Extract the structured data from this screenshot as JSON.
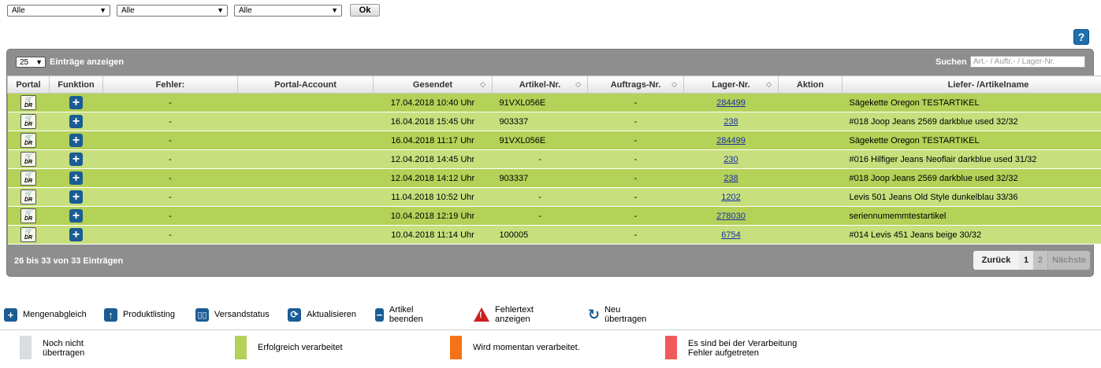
{
  "filters": [
    {
      "value": "Alle"
    },
    {
      "value": "Alle"
    },
    {
      "value": "Alle"
    }
  ],
  "ok_label": "Ok",
  "help_label": "?",
  "panel": {
    "page_length": "25",
    "length_label": "Einträge anzeigen",
    "search_label": "Suchen",
    "search_placeholder": "Art.- / Auftr.- / Lager-Nr."
  },
  "columns": [
    "Portal",
    "Funktion",
    "Fehler:",
    "Portal-Account",
    "Gesendet",
    "Artikel-Nr.",
    "Auftrags-Nr.",
    "Lager-Nr.",
    "Aktion",
    "Liefer- /Artikelname"
  ],
  "rows": [
    {
      "fehler": "-",
      "account": "",
      "gesendet": "17.04.2018 10:40 Uhr",
      "artikel": "91VXL056E",
      "auftrag": "-",
      "lager": "284499",
      "aktion": "",
      "name": "Sägekette Oregon TESTARTIKEL"
    },
    {
      "fehler": "-",
      "account": "",
      "gesendet": "16.04.2018 15:45 Uhr",
      "artikel": "903337",
      "auftrag": "-",
      "lager": "238",
      "aktion": "",
      "name": "#018 Joop Jeans 2569 darkblue used 32/32"
    },
    {
      "fehler": "-",
      "account": "",
      "gesendet": "16.04.2018 11:17 Uhr",
      "artikel": "91VXL056E",
      "auftrag": "-",
      "lager": "284499",
      "aktion": "",
      "name": "Sägekette Oregon TESTARTIKEL"
    },
    {
      "fehler": "-",
      "account": "",
      "gesendet": "12.04.2018 14:45 Uhr",
      "artikel": "-",
      "auftrag": "-",
      "lager": "230",
      "aktion": "",
      "name": "#016 Hilfiger Jeans Neoflair darkblue used 31/32"
    },
    {
      "fehler": "-",
      "account": "",
      "gesendet": "12.04.2018 14:12 Uhr",
      "artikel": "903337",
      "auftrag": "-",
      "lager": "238",
      "aktion": "",
      "name": "#018 Joop Jeans 2569 darkblue used 32/32"
    },
    {
      "fehler": "-",
      "account": "",
      "gesendet": "11.04.2018 10:52 Uhr",
      "artikel": "-",
      "auftrag": "-",
      "lager": "1202",
      "aktion": "",
      "name": "Levis 501 Jeans Old Style dunkelblau 33/36"
    },
    {
      "fehler": "-",
      "account": "",
      "gesendet": "10.04.2018 12:19 Uhr",
      "artikel": "-",
      "auftrag": "-",
      "lager": "278030",
      "aktion": "",
      "name": "seriennumemmtestartikel"
    },
    {
      "fehler": "-",
      "account": "",
      "gesendet": "10.04.2018 11:14 Uhr",
      "artikel": "100005",
      "auftrag": "-",
      "lager": "6754",
      "aktion": "",
      "name": "#014 Levis 451 Jeans beige 30/32"
    }
  ],
  "portal_icon_text": "DR",
  "info": "26 bis 33 von 33 Einträgen",
  "pager": {
    "prev": "Zurück",
    "p1": "1",
    "p2": "2",
    "next": "Nächste"
  },
  "actions": [
    {
      "label": "Mengenabgleich",
      "icon": "plus-icon"
    },
    {
      "label": "Produktlisting",
      "icon": "upload-arrow-icon"
    },
    {
      "label": "Versandstatus",
      "icon": "book-icon"
    },
    {
      "label": "Aktualisieren",
      "icon": "refresh-icon"
    },
    {
      "label": "Artikel beenden",
      "icon": "minus-icon"
    },
    {
      "label": "Fehlertext anzeigen",
      "icon": "warning-icon"
    },
    {
      "label": "Neu übertragen",
      "icon": "redo-icon"
    }
  ],
  "statuses": [
    {
      "label_line1": "Noch nicht",
      "label_line2": "übertragen",
      "color": "#d8dde0"
    },
    {
      "label_line1": "Erfolgreich verarbeitet",
      "label_line2": "",
      "color": "#b4d158"
    },
    {
      "label_line1": "Wird momentan verarbeitet.",
      "label_line2": "",
      "color": "#f57318"
    },
    {
      "label_line1": "Es sind bei der Verarbeitung",
      "label_line2": "Fehler aufgetreten",
      "color": "#f15a5a"
    }
  ]
}
